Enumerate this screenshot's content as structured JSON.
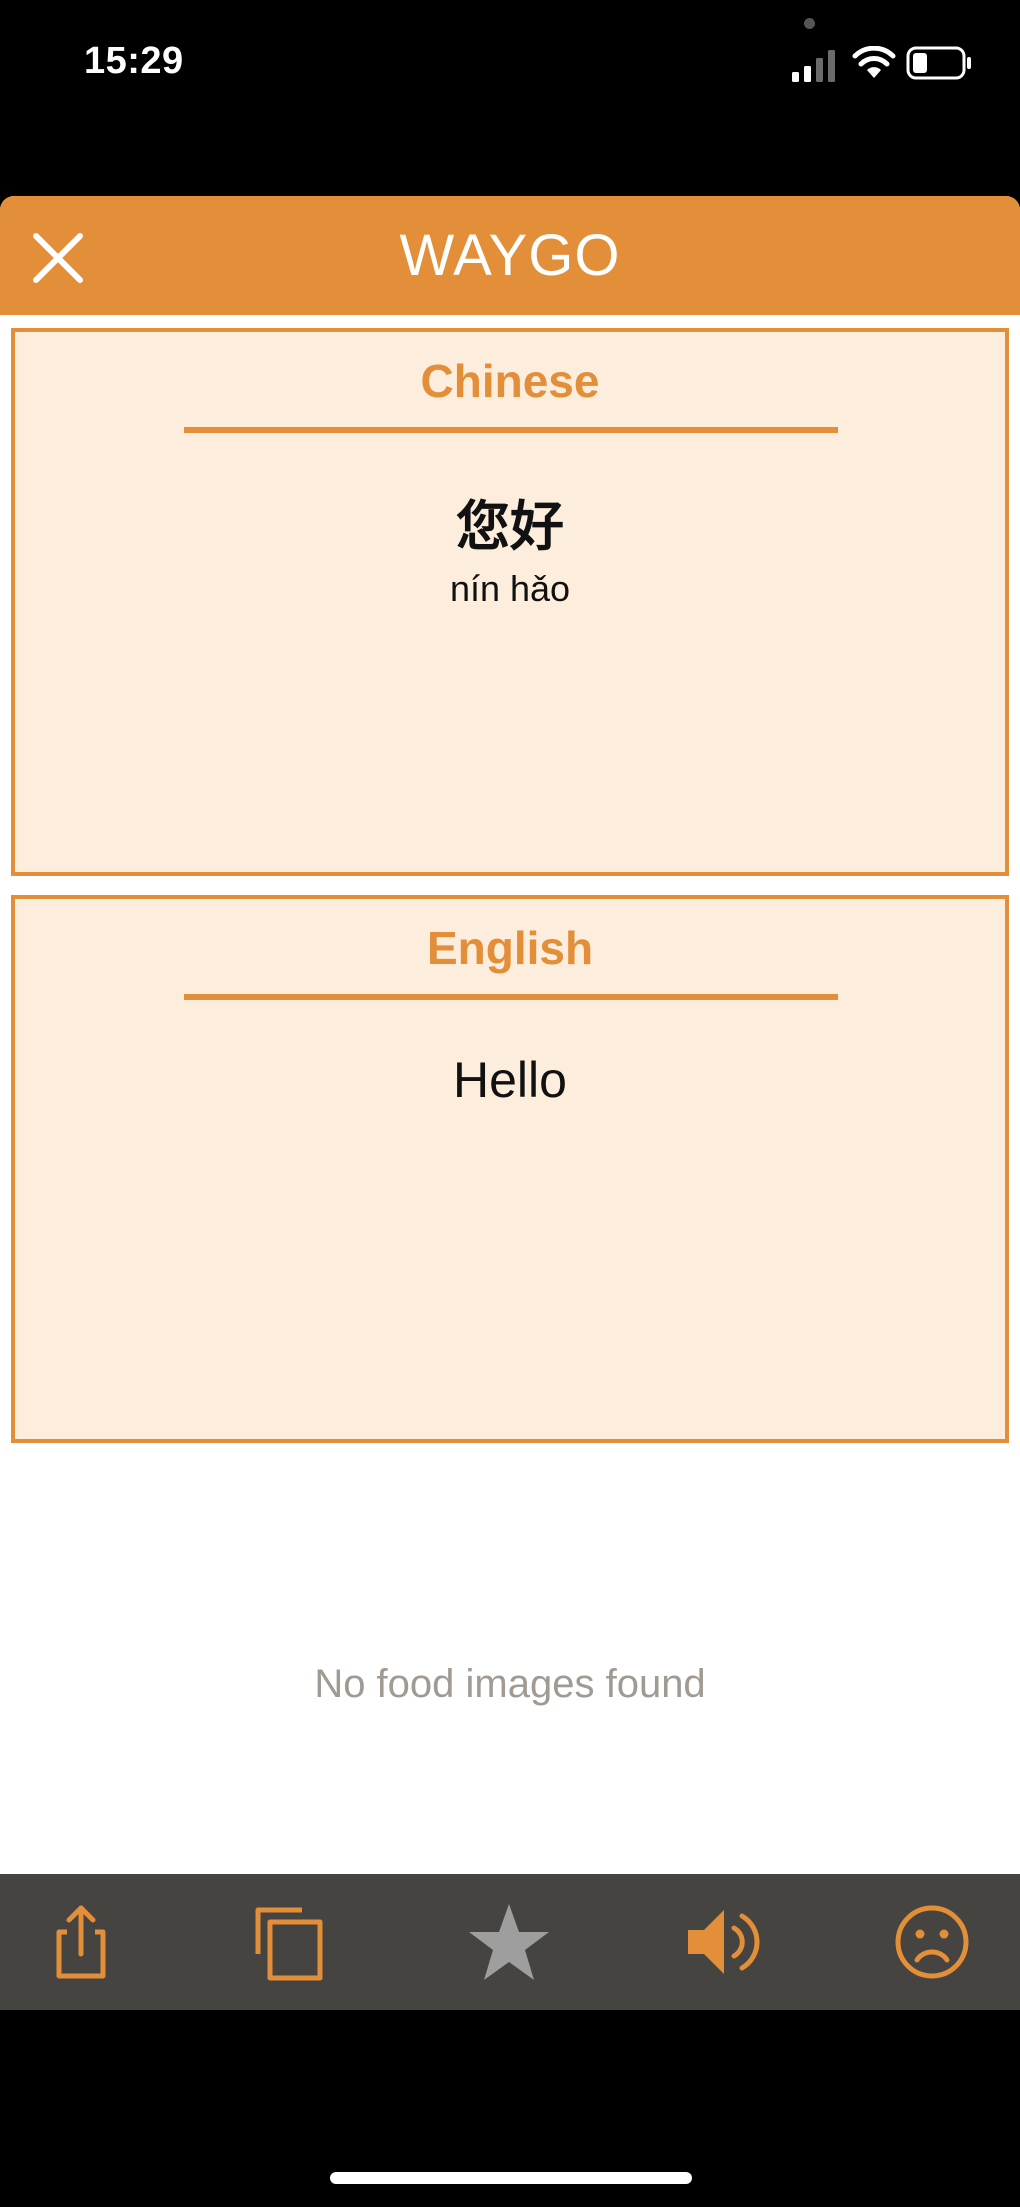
{
  "status_bar": {
    "time": "15:29",
    "icons": [
      "signal-icon",
      "wifi-icon",
      "battery-icon"
    ]
  },
  "header": {
    "title": "WAYGO",
    "close_icon": "close-icon",
    "background": "#E38E38"
  },
  "source_card": {
    "language": "Chinese",
    "text": "您好",
    "pronunciation": "nín hǎo"
  },
  "translation_card": {
    "language": "English",
    "text": "Hello"
  },
  "images_section": {
    "empty_message": "No food images found"
  },
  "toolbar": {
    "buttons": [
      {
        "icon": "share-icon"
      },
      {
        "icon": "copy-icon"
      },
      {
        "icon": "star-icon"
      },
      {
        "icon": "speaker-icon"
      },
      {
        "icon": "sad-face-icon"
      }
    ],
    "background": "#454440",
    "accent": "#E38E38",
    "inactive": "#9E9E9E"
  },
  "colors": {
    "card_fill": "#FCEDDC",
    "accent": "#E38E38",
    "muted_text": "#A09A92"
  }
}
